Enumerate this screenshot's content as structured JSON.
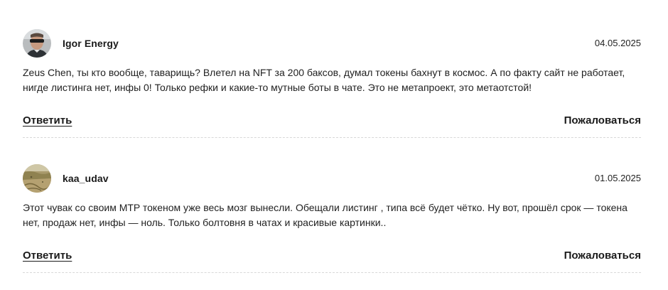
{
  "comments": [
    {
      "author": "Igor Energy",
      "date": "04.05.2025",
      "text": "Zeus Chen, ты кто вообще, таварищь? Влетел на NFT за 200 баксов, думал токены бахнут в космос. А по факту сайт не работает, нигде листинга нет, инфы 0! Только рефки и какие-то мутные боты в чате. Это не метапроект, это метаотстой!",
      "reply_label": "Ответить",
      "report_label": "Пожаловаться"
    },
    {
      "author": "kaa_udav",
      "date": "01.05.2025",
      "text": "Этот чувак со своим MTP токеном уже весь мозг вынесли. Обещали листинг , типа всё будет чётко. Ну вот, прошёл срок — токена нет, продаж нет, инфы — ноль. Только болтовня в чатах и красивые картинки..",
      "reply_label": "Ответить",
      "report_label": "Пожаловаться"
    }
  ]
}
